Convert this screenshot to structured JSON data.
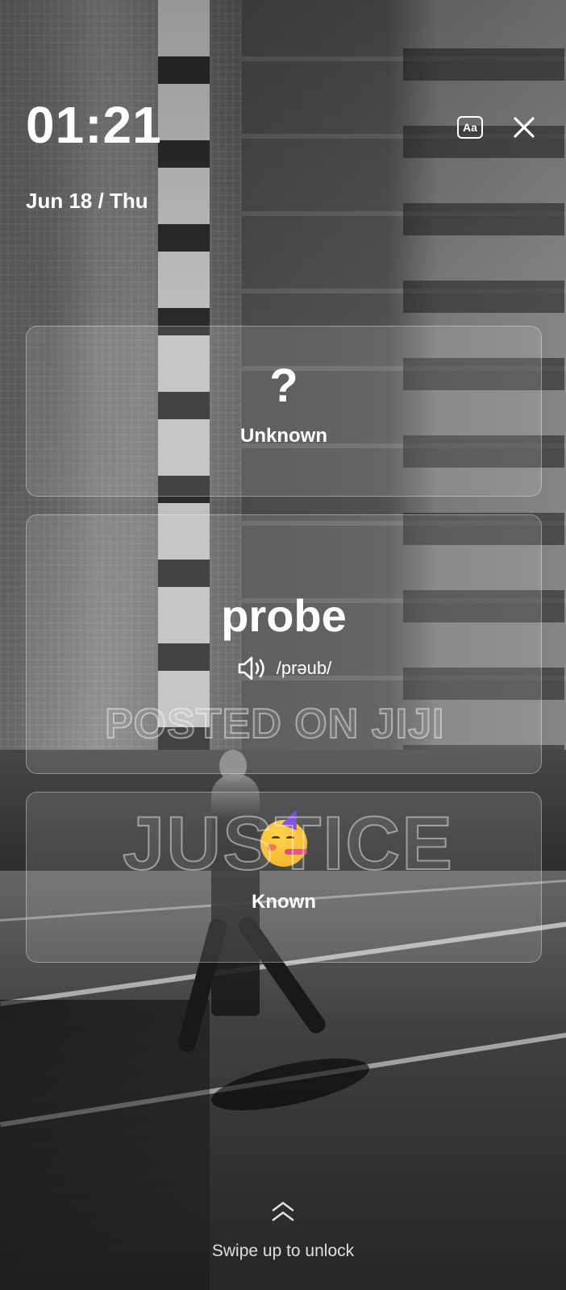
{
  "lockscreen": {
    "time": "01:21",
    "date": "Jun 18 / Thu"
  },
  "toolbar": {
    "font_button_label": "Aa",
    "font_icon": "font-size-icon",
    "close_icon": "close-icon"
  },
  "cards": {
    "unknown": {
      "symbol": "?",
      "label": "Unknown"
    },
    "word": {
      "text": "probe",
      "phonetic": "/prəub/",
      "speaker_icon": "speaker-icon"
    },
    "known": {
      "emoji_icon": "party-face-emoji-icon",
      "label": "Known"
    }
  },
  "watermark": {
    "line1": "POSTED ON JIJI",
    "line2": "JUSTICE"
  },
  "unlock": {
    "hint": "Swipe up to unlock",
    "icon": "chevron-up-double-icon"
  }
}
